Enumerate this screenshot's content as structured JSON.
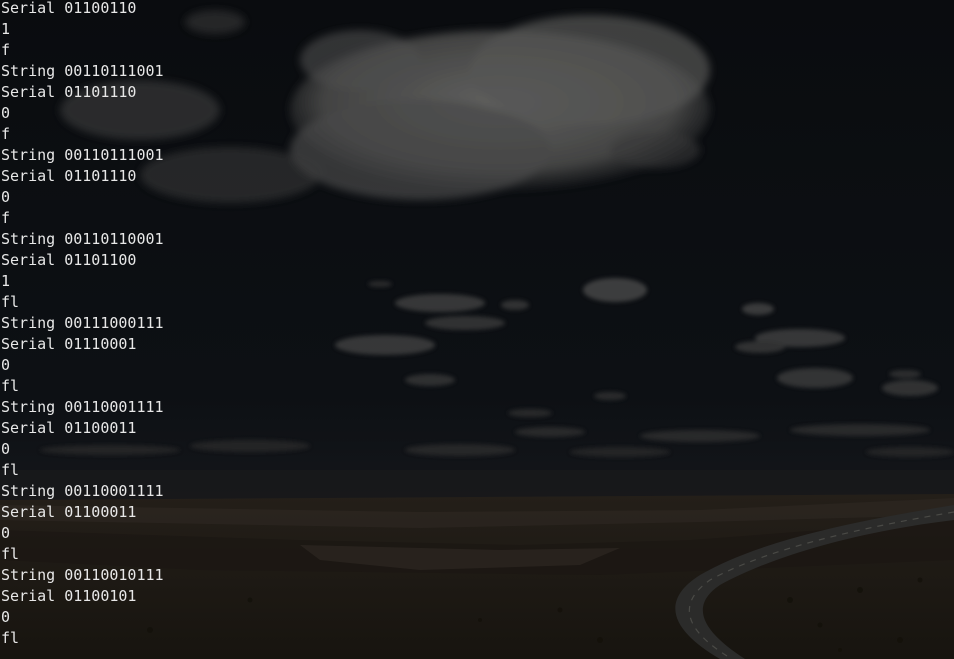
{
  "wallpaper": {
    "sky_color": "#0c0e11",
    "cloud_color": "#5a5a58",
    "ground_color": "#1e1a14",
    "road_color": "#2a2a2a",
    "text_color": "#e8e8e8"
  },
  "terminal": {
    "lines": [
      "Serial 01100110",
      "1",
      "f",
      "String 00110111001",
      "Serial 01101110",
      "0",
      "f",
      "String 00110111001",
      "Serial 01101110",
      "0",
      "f",
      "String 00110110001",
      "Serial 01101100",
      "1",
      "fl",
      "String 00111000111",
      "Serial 01110001",
      "0",
      "fl",
      "String 00110001111",
      "Serial 01100011",
      "0",
      "fl",
      "String 00110001111",
      "Serial 01100011",
      "0",
      "fl",
      "String 00110010111",
      "Serial 01100101",
      "0",
      "fl"
    ]
  }
}
